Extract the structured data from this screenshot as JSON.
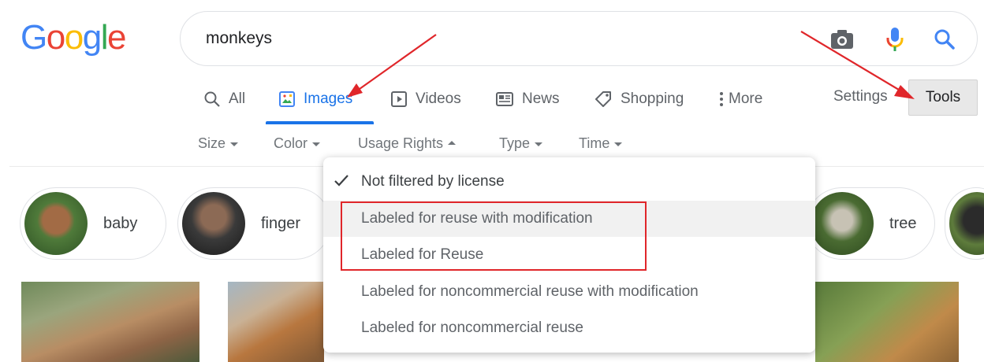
{
  "logo": {
    "text": "Google",
    "letters": [
      "G",
      "o",
      "o",
      "g",
      "l",
      "e"
    ],
    "colors": [
      "#4285f4",
      "#ea4335",
      "#fbbc05",
      "#4285f4",
      "#34a853",
      "#ea4335"
    ]
  },
  "search": {
    "query": "monkeys",
    "icons": [
      "camera-icon",
      "microphone-icon",
      "search-icon"
    ]
  },
  "tabs": {
    "all": "All",
    "images": "Images",
    "videos": "Videos",
    "news": "News",
    "shopping": "Shopping",
    "more": "More",
    "settings": "Settings",
    "tools": "Tools",
    "active": "images"
  },
  "filters": {
    "size": "Size",
    "color": "Color",
    "usage_rights": "Usage Rights",
    "type": "Type",
    "time": "Time"
  },
  "chips": [
    {
      "label": "baby"
    },
    {
      "label": "finger"
    },
    {
      "label": "tree"
    }
  ],
  "usage_menu": {
    "items": [
      "Not filtered by license",
      "Labeled for reuse with modification",
      "Labeled for Reuse",
      "Labeled for noncommercial reuse with modification",
      "Labeled for noncommercial reuse"
    ],
    "selected_index": 0,
    "highlighted_index": 1
  },
  "colors": {
    "accent": "#1a73e8",
    "annotation": "#e0262a",
    "tools_bg": "#e8e8e8"
  }
}
